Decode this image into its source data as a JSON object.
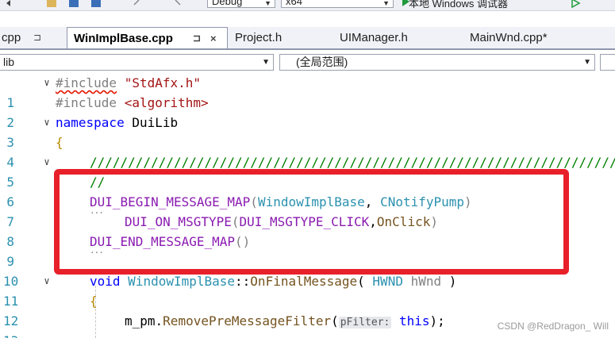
{
  "toolbar": {
    "config_value": "Debug",
    "platform_value": "x64",
    "run_label": "本地 Windows 调试器"
  },
  "tabs": [
    {
      "label": "cpp",
      "pin": "⊐"
    },
    {
      "label": "WinImplBase.cpp",
      "pin": "⊐",
      "close": "×"
    },
    {
      "label": "Project.h"
    },
    {
      "label": "UIManager.h"
    },
    {
      "label": "MainWnd.cpp*"
    }
  ],
  "nav": {
    "project": "lib",
    "scope": "(全局范围)"
  },
  "lines": [
    {
      "num": "1"
    },
    {
      "num": "2"
    },
    {
      "num": "3"
    },
    {
      "num": "4"
    },
    {
      "num": "5"
    },
    {
      "num": "6"
    },
    {
      "num": "7"
    },
    {
      "num": "8"
    },
    {
      "num": "9"
    },
    {
      "num": "10"
    },
    {
      "num": "11"
    },
    {
      "num": "12"
    },
    {
      "num": "13"
    }
  ],
  "code": {
    "l1_directive": "#include",
    "l1_file": "\"StdAfx.h\"",
    "l2_directive": "#include",
    "l2_file": "<algorithm>",
    "l3_kw": "namespace",
    "l3_name": "DuiLib",
    "l4": "{",
    "l5": "////////////////////////////////////////////////////////////////////////",
    "l6": "//",
    "l7_macro": "DUI_BEGIN_MESSAGE_MAP",
    "l7_args_a": "(",
    "l7_class": "WindowImplBase",
    "l7_comma": ", ",
    "l7_base": "CNotifyPump",
    "l7_close": ")",
    "l8_macro": "DUI_ON_MSGTYPE",
    "l8_open": "(",
    "l8_type": "DUI_MSGTYPE_CLICK",
    "l8_sep": ",",
    "l8_handler": "OnClick",
    "l8_close": ")",
    "l9_macro": "DUI_END_MESSAGE_MAP",
    "l9_paren": "()",
    "l11_kw": "void",
    "l11_class": "WindowImplBase",
    "l11_scope": "::",
    "l11_fn": "OnFinalMessage",
    "l11_open": "( ",
    "l11_type": "HWND",
    "l11_param": " hWnd ",
    "l11_close": ")",
    "l12": "{",
    "l13_obj": "m_pm",
    "l13_dot": ".",
    "l13_fn": "RemovePreMessageFilter",
    "l13_open": "(",
    "l13_hint": "pFilter:",
    "l13_this": "this",
    "l13_end": ");"
  },
  "watermark": "CSDN @RedDragon_ Will",
  "colors": {
    "highlight_box": "#e8202a",
    "line_number": "#2b91af",
    "keyword": "#0000ff",
    "macro": "#8a1bb0",
    "string": "#a31515",
    "comment": "#008000"
  }
}
